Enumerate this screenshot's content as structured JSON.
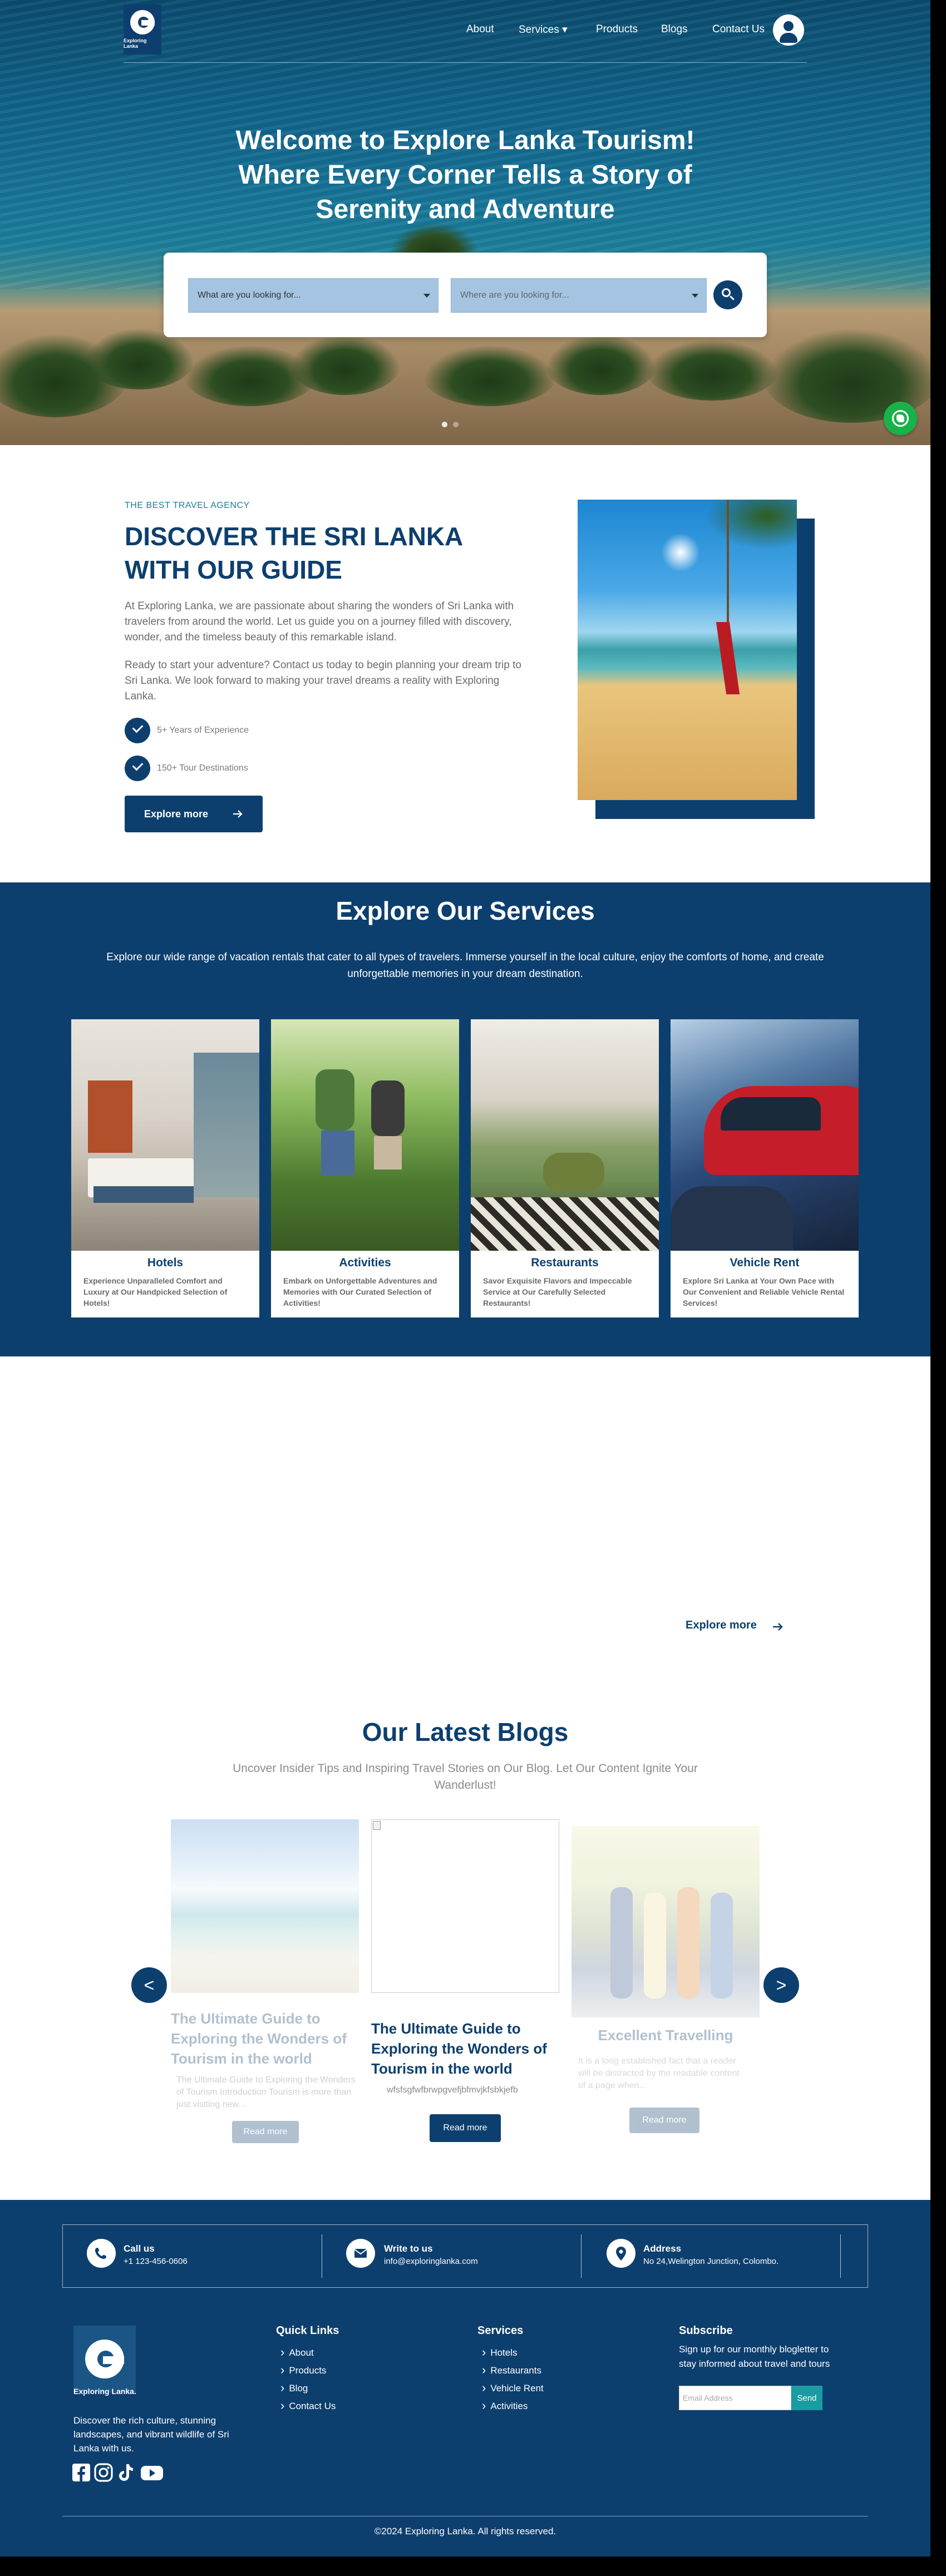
{
  "header": {
    "logo_text": "Exploring Lanka",
    "nav": [
      "About",
      "Services ▾",
      "Products",
      "Blogs",
      "Contact Us"
    ]
  },
  "hero": {
    "title": "Welcome to Explore Lanka Tourism! Where Every Corner Tells a Story of Serenity and Adventure",
    "select1": "What are you looking for...",
    "select2": "Where are you looking for...",
    "carousel_dots": 2
  },
  "about": {
    "kicker": "THE BEST TRAVEL AGENCY",
    "title": "DISCOVER THE SRI LANKA WITH OUR GUIDE",
    "p1": "At Exploring Lanka, we are passionate about sharing the wonders of Sri Lanka with travelers from around the world. Let us guide you on a journey filled with discovery, wonder, and the timeless beauty of this remarkable island.",
    "p2": "Ready to start your adventure? Contact us today to begin planning your dream trip to Sri Lanka. We look forward to making your travel dreams a reality with Exploring Lanka.",
    "point1": "5+ Years of Experience",
    "point2": "150+ Tour Destinations",
    "button": "Explore more"
  },
  "services": {
    "title": "Explore Our Services",
    "description": "Explore our wide range of vacation rentals that cater to all types of travelers. Immerse yourself in the local culture, enjoy the comforts of home, and create unforgettable memories in your dream destination.",
    "cards": [
      {
        "title": "Hotels",
        "desc": "Experience Unparalleled Comfort and Luxury at Our Handpicked Selection of Hotels!"
      },
      {
        "title": "Activities",
        "desc": "Embark on Unforgettable Adventures and Memories with Our Curated Selection of Activities!"
      },
      {
        "title": "Restaurants",
        "desc": "Savor Exquisite Flavors and Impeccable Service at Our Carefully Selected Restaurants!"
      },
      {
        "title": "Vehicle Rent",
        "desc": "Explore Sri Lanka at Your Own Pace with Our Convenient and Reliable Vehicle Rental Services!"
      }
    ]
  },
  "explore_more": "Explore more",
  "blogs": {
    "title": "Our Latest Blogs",
    "subtitle": "Uncover Insider Tips and Inspiring Travel Stories on Our Blog. Let Our Content Ignite Your Wanderlust!",
    "prev": "<",
    "next": ">",
    "items": [
      {
        "title": "The Ultimate Guide to Exploring the Wonders of Tourism in the world",
        "excerpt": "The Ultimate Guide to Exploring the Wonders of Tourism Introduction Tourism is more than just visiting new...",
        "button": "Read more"
      },
      {
        "title": "The Ultimate Guide to Exploring the Wonders of Tourism in the world",
        "excerpt": "wfsfsgfwfbrwpgvefjbfmvjkfsbkjefb",
        "button": "Read more"
      },
      {
        "title": "Excellent Travelling",
        "excerpt": "It is a long established fact that a reader will be distracted by the readable content of a page when...",
        "button": "Read more"
      }
    ]
  },
  "footer": {
    "call_title": "Call us",
    "call_value": "+1 123-456-0606",
    "write_title": "Write to us",
    "write_value": "info@exploringlanka.com",
    "address_title": "Address",
    "address_value": "No 24,Welington Junction, Colombo.",
    "logo_text": "Exploring Lanka.",
    "description": "Discover the rich culture, stunning landscapes, and vibrant wildlife of Sri Lanka with us.",
    "quick_links_title": "Quick Links",
    "quick_links": [
      "About",
      "Products",
      "Blog",
      "Contact Us"
    ],
    "services_title": "Services",
    "services": [
      "Hotels",
      "Restaurants",
      "Vehicle Rent",
      "Activities"
    ],
    "subscribe_title": "Subscribe",
    "subscribe_text": "Sign up for our monthly blogletter to stay informed about travel and tours",
    "email_placeholder": "Email Address",
    "send": "Send",
    "copyright": "©2024 Exploring Lanka. All rights reserved."
  },
  "colors": {
    "brand_navy": "#0d3f6e",
    "teal": "#1a9ca2",
    "whatsapp": "#18b24a"
  },
  "icons": [
    "search-icon",
    "user-icon",
    "whatsapp-icon",
    "check-icon",
    "arrow-right-icon",
    "phone-icon",
    "mail-icon",
    "location-icon",
    "facebook-icon",
    "instagram-icon",
    "tiktok-icon",
    "youtube-icon"
  ]
}
